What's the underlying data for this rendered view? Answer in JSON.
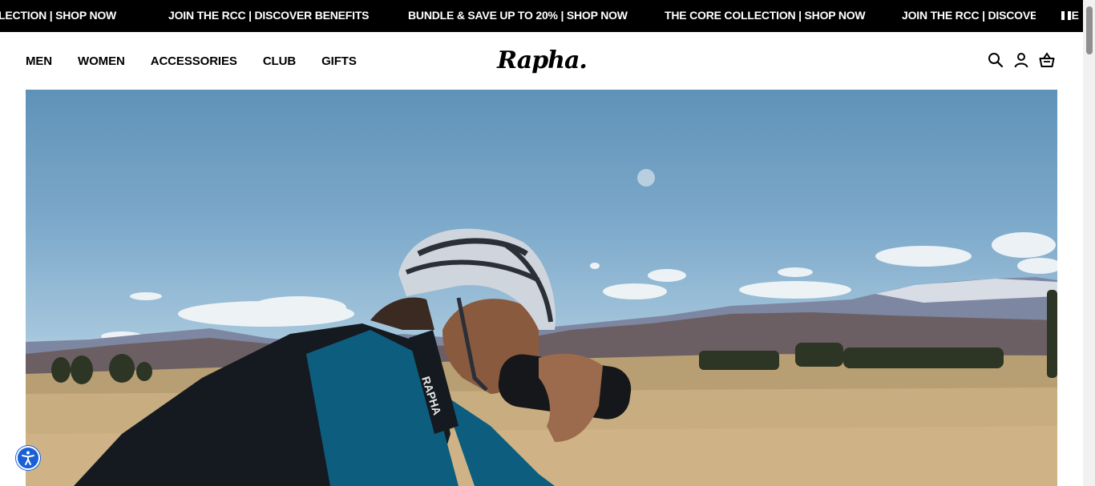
{
  "announcement_bar": {
    "messages": [
      "LECTION | SHOP NOW",
      "JOIN THE RCC | DISCOVER BENEFITS",
      "BUNDLE & SAVE UP TO 20% | SHOP NOW",
      "THE CORE COLLECTION | SHOP NOW",
      "JOIN THE RCC | DISCOVER BENE"
    ],
    "pause_icon": "pause-icon"
  },
  "nav": {
    "items": [
      "MEN",
      "WOMEN",
      "ACCESSORIES",
      "CLUB",
      "GIFTS"
    ]
  },
  "brand": {
    "logo_text": "Rapha."
  },
  "header_icons": [
    "search-icon",
    "account-icon",
    "basket-icon"
  ],
  "hero": {
    "jersey_text": "RAPHA",
    "image_subject": "cyclist drinking from bottle"
  },
  "accessibility": {
    "icon": "accessibility-icon",
    "color": "#1a5fd6"
  },
  "colors": {
    "bar_background": "#000000",
    "text": "#000000"
  }
}
